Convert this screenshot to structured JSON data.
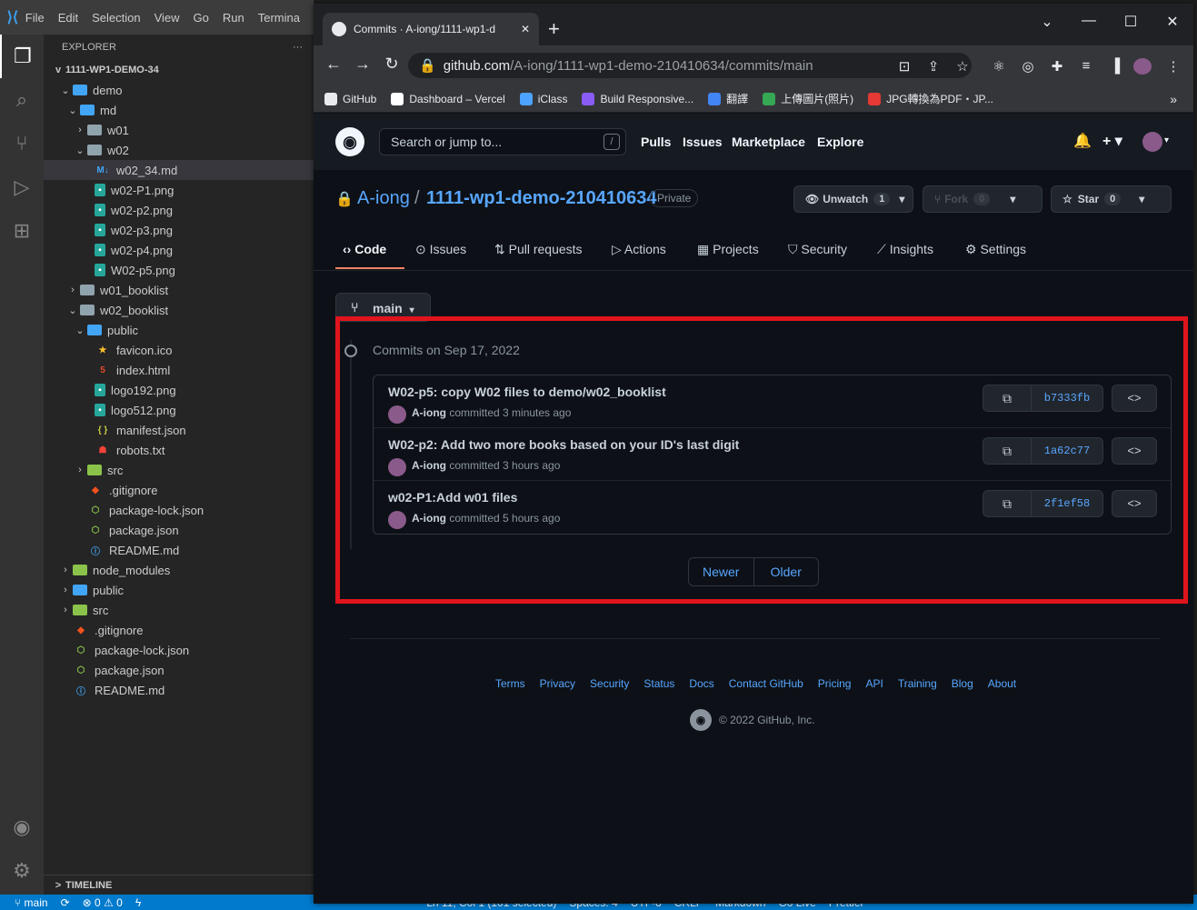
{
  "vscode": {
    "menu": [
      "File",
      "Edit",
      "Selection",
      "View",
      "Go",
      "Run",
      "Termina"
    ],
    "explorer_title": "EXPLORER",
    "explorer_more": "···",
    "root_folder": "1111-WP1-DEMO-34",
    "tree": [
      {
        "label": "demo",
        "indent": 1,
        "chev": "v",
        "icon": "folder-c"
      },
      {
        "label": "md",
        "indent": 2,
        "chev": "v",
        "icon": "folder-c"
      },
      {
        "label": "w01",
        "indent": 3,
        "chev": ">",
        "icon": "folder"
      },
      {
        "label": "w02",
        "indent": 3,
        "chev": "v",
        "icon": "folder"
      },
      {
        "label": "w02_34.md",
        "indent": 4,
        "chev": "",
        "icon": "md",
        "selected": true
      },
      {
        "label": "w02-P1.png",
        "indent": 4,
        "chev": "",
        "icon": "img"
      },
      {
        "label": "w02-p2.png",
        "indent": 4,
        "chev": "",
        "icon": "img"
      },
      {
        "label": "w02-p3.png",
        "indent": 4,
        "chev": "",
        "icon": "img"
      },
      {
        "label": "w02-p4.png",
        "indent": 4,
        "chev": "",
        "icon": "img"
      },
      {
        "label": "W02-p5.png",
        "indent": 4,
        "chev": "",
        "icon": "img"
      },
      {
        "label": "w01_booklist",
        "indent": 2,
        "chev": ">",
        "icon": "folder"
      },
      {
        "label": "w02_booklist",
        "indent": 2,
        "chev": "v",
        "icon": "folder"
      },
      {
        "label": "public",
        "indent": 3,
        "chev": "v",
        "icon": "folder-c"
      },
      {
        "label": "favicon.ico",
        "indent": 4,
        "chev": "",
        "icon": "star"
      },
      {
        "label": "index.html",
        "indent": 4,
        "chev": "",
        "icon": "html"
      },
      {
        "label": "logo192.png",
        "indent": 4,
        "chev": "",
        "icon": "img"
      },
      {
        "label": "logo512.png",
        "indent": 4,
        "chev": "",
        "icon": "img"
      },
      {
        "label": "manifest.json",
        "indent": 4,
        "chev": "",
        "icon": "json"
      },
      {
        "label": "robots.txt",
        "indent": 4,
        "chev": "",
        "icon": "robot"
      },
      {
        "label": "src",
        "indent": 3,
        "chev": ">",
        "icon": "folder-g"
      },
      {
        "label": ".gitignore",
        "indent": 3,
        "chev": "",
        "icon": "git"
      },
      {
        "label": "package-lock.json",
        "indent": 3,
        "chev": "",
        "icon": "npm"
      },
      {
        "label": "package.json",
        "indent": 3,
        "chev": "",
        "icon": "npm"
      },
      {
        "label": "README.md",
        "indent": 3,
        "chev": "",
        "icon": "info"
      },
      {
        "label": "node_modules",
        "indent": 1,
        "chev": ">",
        "icon": "folder-g"
      },
      {
        "label": "public",
        "indent": 1,
        "chev": ">",
        "icon": "folder-c"
      },
      {
        "label": "src",
        "indent": 1,
        "chev": ">",
        "icon": "folder-g"
      },
      {
        "label": ".gitignore",
        "indent": 1,
        "chev": "",
        "icon": "git"
      },
      {
        "label": "package-lock.json",
        "indent": 1,
        "chev": "",
        "icon": "npm"
      },
      {
        "label": "package.json",
        "indent": 1,
        "chev": "",
        "icon": "npm"
      },
      {
        "label": "README.md",
        "indent": 1,
        "chev": "",
        "icon": "info"
      }
    ],
    "timeline": "TIMELINE",
    "status": {
      "branch": "main",
      "errors": "0",
      "warnings": "0",
      "right": [
        "Ln 11, Col 1 (101 selected)",
        "Spaces: 4",
        "UTF-8",
        "CRLF",
        "Markdown",
        "Go Live",
        "Prettier"
      ]
    }
  },
  "browser": {
    "tab_title": "Commits · A-iong/1111-wp1-d",
    "url_host": "github.com",
    "url_path": "/A-iong/1111-wp1-demo-210410634/commits/main",
    "bookmarks": [
      {
        "label": "GitHub",
        "color": "#e8eaed"
      },
      {
        "label": "Dashboard – Vercel",
        "color": "#ffffff"
      },
      {
        "label": "iClass",
        "color": "#4da3ff"
      },
      {
        "label": "Build Responsive...",
        "color": "#8a5cf6"
      },
      {
        "label": "翻譯",
        "color": "#4285f4"
      },
      {
        "label": "上傳圖片(照片)",
        "color": "#34a853"
      },
      {
        "label": "JPG轉換為PDF・JP...",
        "color": "#e53935"
      }
    ]
  },
  "github": {
    "search_placeholder": "Search or jump to...",
    "search_key": "/",
    "nav": [
      "Pulls",
      "Issues",
      "Marketplace",
      "Explore"
    ],
    "owner": "A-iong",
    "separator": "/",
    "repo": "1111-wp1-demo-210410634",
    "visibility": "Private",
    "unwatch": {
      "label": "Unwatch",
      "count": "1"
    },
    "fork": {
      "label": "Fork",
      "count": "0"
    },
    "star": {
      "label": "Star",
      "count": "0"
    },
    "tabs": [
      "Code",
      "Issues",
      "Pull requests",
      "Actions",
      "Projects",
      "Security",
      "Insights",
      "Settings"
    ],
    "branch": "main",
    "commits_date": "Commits on Sep 17, 2022",
    "commits": [
      {
        "title": "W02-p5: copy W02 files to demo/w02_booklist",
        "author": "A-iong",
        "time": "committed 3 minutes ago",
        "sha": "b7333fb"
      },
      {
        "title": "W02-p2: Add two more books based on your ID's last digit",
        "author": "A-iong",
        "time": "committed 3 hours ago",
        "sha": "1a62c77"
      },
      {
        "title": "w02-P1:Add w01 files",
        "author": "A-iong",
        "time": "committed 5 hours ago",
        "sha": "2f1ef58"
      }
    ],
    "pager": {
      "newer": "Newer",
      "older": "Older"
    },
    "footer_links": [
      "Terms",
      "Privacy",
      "Security",
      "Status",
      "Docs",
      "Contact GitHub",
      "Pricing",
      "API",
      "Training",
      "Blog",
      "About"
    ],
    "copyright": "© 2022 GitHub, Inc."
  }
}
